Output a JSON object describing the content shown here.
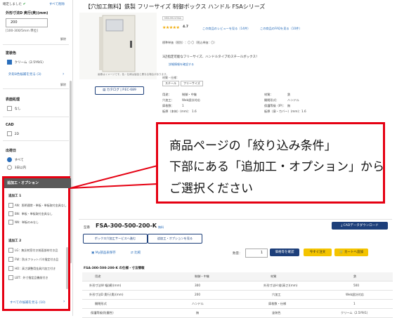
{
  "sidebar": {
    "confirmed_label": "確定しました",
    "clear_all": "すべて削除",
    "width_label": "外形寸法D 奥行(奥)(mm)",
    "width_value": "200",
    "range_hint": "[100-300/5mm 単位]",
    "confirm_small": "解除",
    "coating_label": "塗装色",
    "coating_option": "クリーム（2.5Y9/1）",
    "coating_more": "外形8色候補を見る (3)",
    "surface_label": "表面処理",
    "surface_option": "なし",
    "cad_label": "CAD",
    "cad_option": "2D",
    "ship_label": "出荷日",
    "ship_option1": "すべて",
    "ship_option2": "3日以内",
    "small_release": "解除"
  },
  "options_panel": {
    "header": "追加工・オプション",
    "group1": "追加工 1",
    "group1_items": [
      "AN：照明通常・単板・単板取付金具なし",
      "BN：単板・単板取付金具なし",
      "NN：単板のみなし"
    ],
    "group2": "追加工 2",
    "group2_items": [
      "LG：無反射窓付き前面部材付き品",
      "FW：防水フラットパネ指定付き品",
      "HO：高さ調整用金具穴加工付き",
      "LBT：外寸指定品機前付き"
    ],
    "more_link": "すべての候補を見る (10)"
  },
  "product": {
    "title": "【穴加工無料】鉄製 フリーサイズ 制御ボックス ハンドル FSAシリーズ",
    "badge": "MISUMI-VONA",
    "rating": "4.7",
    "reviews_link": "この商品のレビューを見る（14件）",
    "faq_link": "この商品のFAQを見る（10件）",
    "stock_line": "標準単価（税別）：〇 〇（税込単価：〇）",
    "description": "3辺指定可能なフリーサイズ、ハンドルタイプのスチールボックス！",
    "spec_link": "詳細情報を確認する",
    "tags_label": "材質・仕様：",
    "tag1": "スチール",
    "tag2": "フリーサイズ",
    "catalog_button": "カタログ | P.EC-689",
    "image_caption": "画像はイメージです。色・仕様は製品と異なる場合があります。",
    "spec_rows": [
      [
        "用途：",
        "制御・中継",
        "材質：",
        "鉄"
      ],
      [
        "穴加工：",
        "Web設計対応",
        "開閉形式：",
        "ハンドル"
      ],
      [
        "扉枚数：",
        "1",
        "保護等級（IP）：",
        "無"
      ],
      [
        "板厚（本体）(mm)：",
        "1.6",
        "板厚（扉・カバー）(mm)：",
        "1.6"
      ],
      [
        "扉厚：",
        "1.6",
        "",
        ""
      ]
    ]
  },
  "callout": {
    "line1": "商品ページの「絞り込み条件」",
    "line2": "下部にある「追加工・オプション」から",
    "line3": "ご選択ください"
  },
  "lower": {
    "model_label": "型番",
    "model_number": "FSA-300-500-200-K",
    "model_badge": "無料",
    "cad_button": "CADデータダウンロード",
    "service_button": "ボックス穴加工サービスへ進む",
    "option_button": "追加工・オプションを見る",
    "save_link": "My部品表保存",
    "compare_link": "比較",
    "qty_label": "数量：",
    "qty_value": "1",
    "price_button": "価格等を確認",
    "order_button": "今すぐ注文",
    "cart_button": "カートへ追加",
    "table_title": "FSA-300-500-200-K の仕様・寸法情報",
    "table_rows": [
      [
        "用途",
        "制御・中継",
        "材質",
        "鉄"
      ],
      [
        "外形寸法W 幅(横)(mm)",
        "300",
        "外形寸法H 縦(高さ)(mm)",
        "500"
      ],
      [
        "外形寸法D 奥行(奥)(mm)",
        "200",
        "穴加工",
        "Web設計対応"
      ],
      [
        "開閉形式",
        "ハンドル",
        "扉枚数・仕様",
        "1"
      ],
      [
        "保護等級(防塵性)",
        "無",
        "塗装色",
        "クリーム（2.5Y9/1）"
      ]
    ]
  },
  "colors": {
    "accent_red": "#e50012",
    "navy": "#1d3f7a",
    "yellow": "#f4c400",
    "link": "#2a6ebb"
  }
}
